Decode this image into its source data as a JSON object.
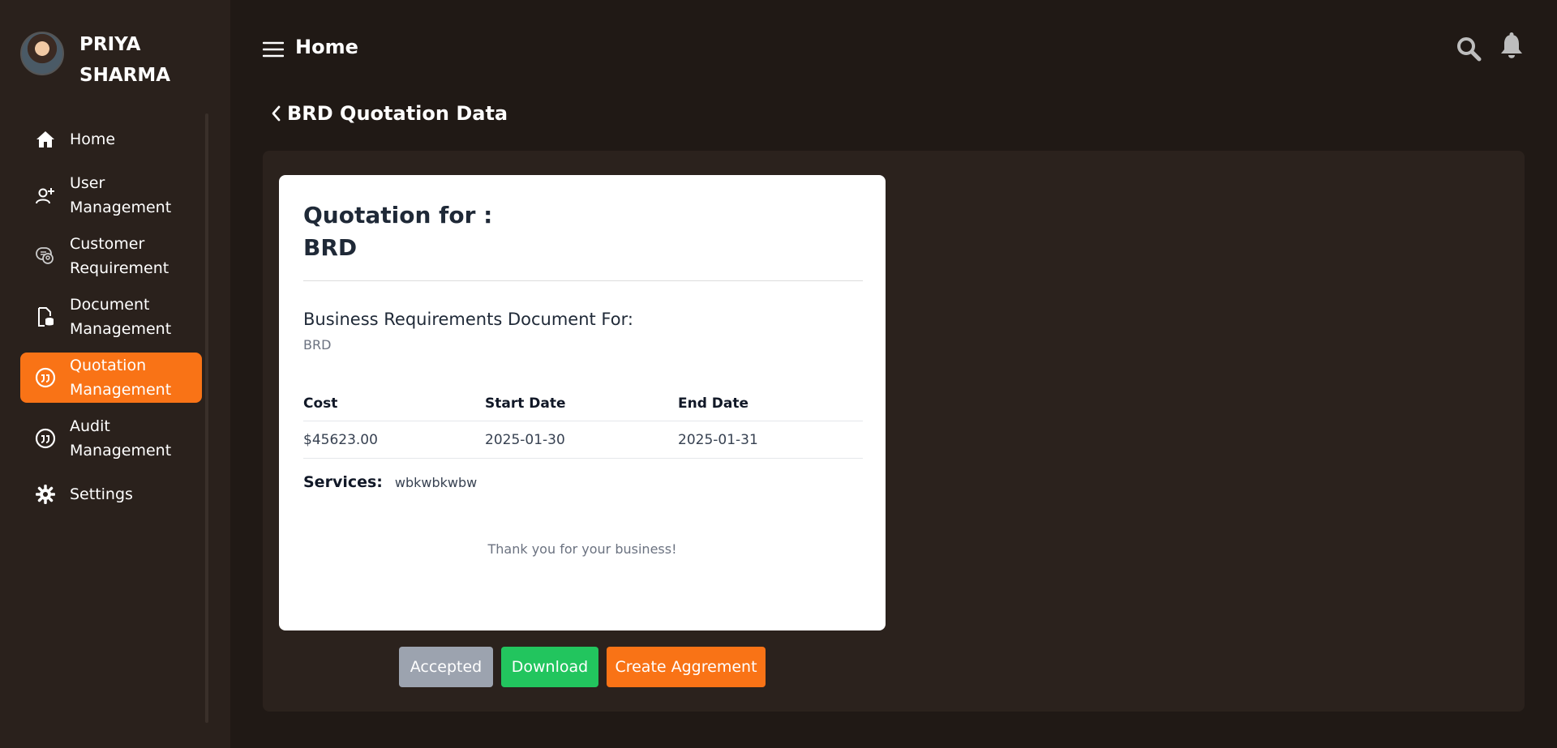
{
  "user": {
    "name": "PRIYA SHARMA"
  },
  "header": {
    "title": "Home"
  },
  "sidebar": {
    "items": [
      {
        "label": "Home",
        "icon": "home-icon",
        "active": false
      },
      {
        "label": "User Management",
        "icon": "user-plus-icon",
        "active": false
      },
      {
        "label": "Customer Requirement",
        "icon": "customer-requirement-icon",
        "active": false
      },
      {
        "label": "Document Management",
        "icon": "document-database-icon",
        "active": false
      },
      {
        "label": "Quotation Management",
        "icon": "quotation-icon",
        "active": true
      },
      {
        "label": "Audit Management",
        "icon": "audit-icon",
        "active": false
      },
      {
        "label": "Settings",
        "icon": "gear-icon",
        "active": false
      }
    ]
  },
  "page": {
    "back_title": "BRD Quotation Data"
  },
  "quotation": {
    "title_line1": "Quotation for :",
    "title_line2": "BRD",
    "doc_heading": "Business Requirements Document For:",
    "doc_subject": "BRD",
    "columns": [
      "Cost",
      "Start Date",
      "End Date"
    ],
    "row": [
      "$45623.00",
      "2025-01-30",
      "2025-01-31"
    ],
    "services_label": "Services:",
    "services_value": "wbkwbkwbw",
    "thanks": "Thank you for your business!"
  },
  "actions": {
    "accepted_label": "Accepted",
    "download_label": "Download",
    "agreement_label": "Create Aggrement"
  },
  "colors": {
    "accent": "#f97316",
    "success": "#22c55e",
    "disabled": "#9ca3af",
    "sidebar_bg": "#2a211c",
    "page_bg": "#201915"
  }
}
